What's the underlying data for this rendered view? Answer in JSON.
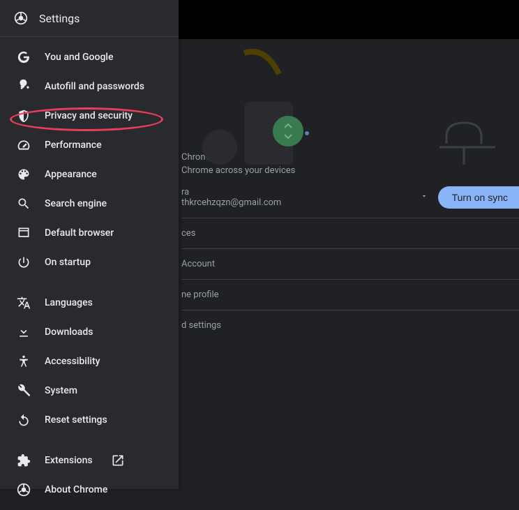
{
  "header": {
    "title": "Settings"
  },
  "sidebar": {
    "group1": [
      {
        "label": "You and Google",
        "icon": "google-g-icon",
        "name": "sidebar-item-you-and-google"
      },
      {
        "label": "Autofill and passwords",
        "icon": "key-icon",
        "name": "sidebar-item-autofill"
      },
      {
        "label": "Privacy and security",
        "icon": "shield-icon",
        "name": "sidebar-item-privacy",
        "highlighted": true
      },
      {
        "label": "Performance",
        "icon": "speedometer-icon",
        "name": "sidebar-item-performance"
      },
      {
        "label": "Appearance",
        "icon": "palette-icon",
        "name": "sidebar-item-appearance"
      },
      {
        "label": "Search engine",
        "icon": "search-icon",
        "name": "sidebar-item-search-engine"
      },
      {
        "label": "Default browser",
        "icon": "browser-icon",
        "name": "sidebar-item-default-browser"
      },
      {
        "label": "On startup",
        "icon": "power-icon",
        "name": "sidebar-item-on-startup"
      }
    ],
    "group2": [
      {
        "label": "Languages",
        "icon": "translate-icon",
        "name": "sidebar-item-languages"
      },
      {
        "label": "Downloads",
        "icon": "download-icon",
        "name": "sidebar-item-downloads"
      },
      {
        "label": "Accessibility",
        "icon": "accessibility-icon",
        "name": "sidebar-item-accessibility"
      },
      {
        "label": "System",
        "icon": "wrench-icon",
        "name": "sidebar-item-system"
      },
      {
        "label": "Reset settings",
        "icon": "reset-icon",
        "name": "sidebar-item-reset"
      }
    ],
    "group3": [
      {
        "label": "Extensions",
        "icon": "extension-icon",
        "name": "sidebar-item-extensions",
        "external": true
      },
      {
        "label": "About Chrome",
        "icon": "chrome-logo-icon",
        "name": "sidebar-item-about"
      }
    ]
  },
  "main": {
    "hero_line1": "Chrome",
    "hero_line2": "Chrome across your devices",
    "account_name_partial": "ra",
    "email": "thkrcehzqzn@gmail.com",
    "sync_button": "Turn on sync",
    "rows": [
      "ces",
      "Account",
      "ne profile",
      "d settings"
    ]
  },
  "annotation": {
    "highlighted_item": "Privacy and security",
    "highlight_color": "#e83e5b"
  }
}
